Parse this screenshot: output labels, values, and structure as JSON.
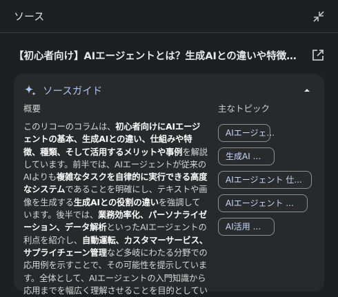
{
  "header": {
    "title": "ソース"
  },
  "source": {
    "title": "【初心者向け】AIエージェントとは？生成AIとの違いや特徴、活用..."
  },
  "guide": {
    "title": "ソースガイド",
    "summary_heading": "概要",
    "topics_heading": "主なトピック",
    "summary_segments": [
      {
        "text": "このリコーのコラムは、",
        "bold": false
      },
      {
        "text": "初心者向けにAIエージェントの基本、生成AIとの違い、仕組みや特徴、種類、そして活用するメリットや事例",
        "bold": true
      },
      {
        "text": "を解説しています。前半では、AIエージェントが従来のAIよりも",
        "bold": false
      },
      {
        "text": "複雑なタスクを自律的に実行できる高度なシステム",
        "bold": true
      },
      {
        "text": "であることを明確にし、テキストや画像を生成する",
        "bold": false
      },
      {
        "text": "生成AIとの役割の違い",
        "bold": true
      },
      {
        "text": "を強調しています。後半では、",
        "bold": false
      },
      {
        "text": "業務効率化、パーソナライゼーション、データ解析",
        "bold": true
      },
      {
        "text": "といったAIエージェントの利点を紹介し、",
        "bold": false
      },
      {
        "text": "自動運転、カスタマーサービス、サプライチェーン管理",
        "bold": true
      },
      {
        "text": "など多岐にわたる分野での応用例を示すことで、その可能性を提示しています。全体として、AIエージェントの入門知識から応用までを幅広く理解させることを目的としています。",
        "bold": false
      }
    ],
    "topics": [
      "AIエージェ...",
      "生成AI ...",
      "AIエージェント 仕...",
      "AIエージェント ...",
      "AI活用 ..."
    ]
  },
  "colors": {
    "background": "#1e1f20",
    "card": "#28292a",
    "accent": "#a8c7fa",
    "chip_border": "#8e918f"
  },
  "icons": {
    "collapse": "collapse-icon",
    "open_external": "open-in-new-icon",
    "sparkle": "sparkle-icon",
    "chevron_up": "chevron-up-icon"
  }
}
